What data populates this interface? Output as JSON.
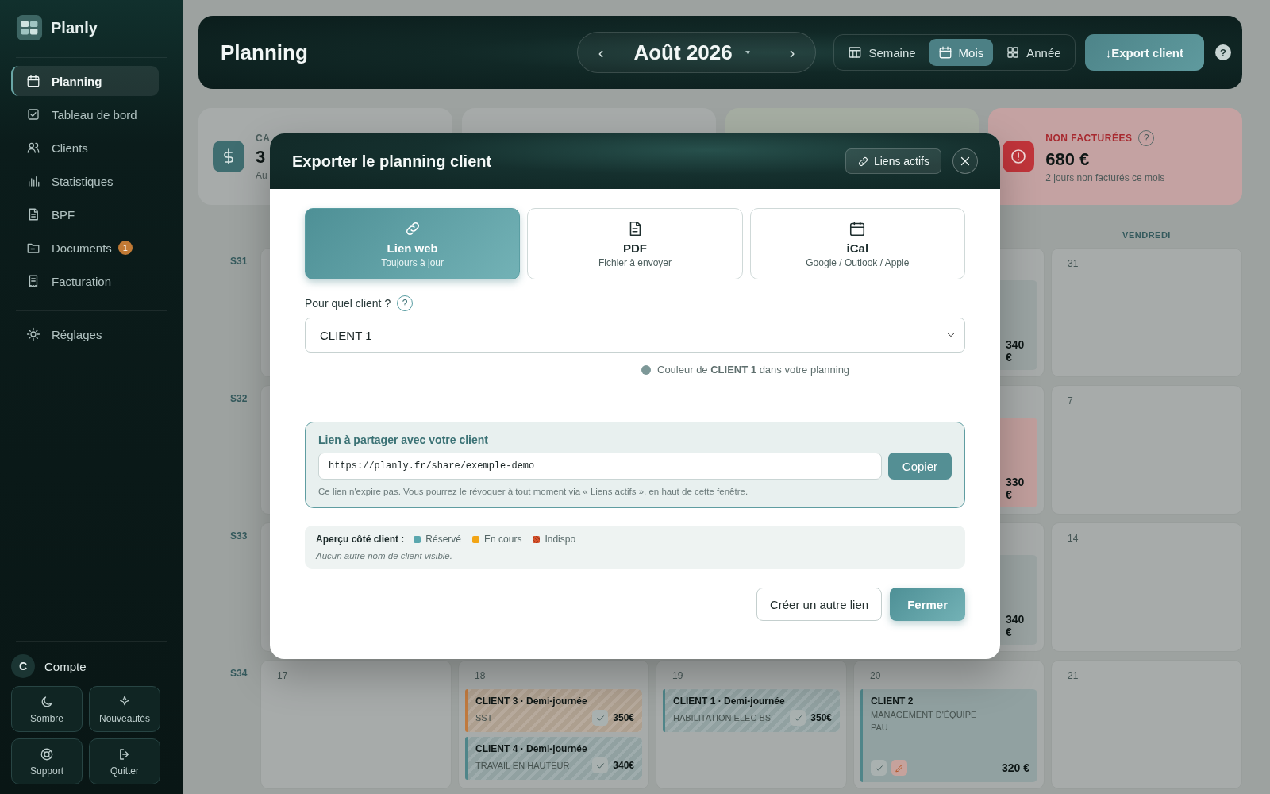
{
  "sidebar": {
    "brand": "Planly",
    "nav": [
      {
        "label": "Planning",
        "selected": true
      },
      {
        "label": "Tableau de bord",
        "selected": false
      },
      {
        "label": "Clients",
        "selected": false
      },
      {
        "label": "Statistiques",
        "selected": false
      },
      {
        "label": "BPF",
        "selected": false
      },
      {
        "label": "Documents",
        "selected": false,
        "badge": "1"
      },
      {
        "label": "Facturation",
        "selected": false
      }
    ],
    "settings": {
      "label": "Réglages",
      "selected": false
    },
    "account": {
      "initial": "C",
      "label": "Compte"
    },
    "actions": [
      {
        "label": "Sombre"
      },
      {
        "label": "Nouveautés"
      },
      {
        "label": "Support"
      },
      {
        "label": "Quitter"
      }
    ]
  },
  "header": {
    "title": "Planning",
    "prev": "‹",
    "month": "Août 2026",
    "next": "›",
    "views": [
      {
        "label": "Semaine",
        "selected": false
      },
      {
        "label": "Mois",
        "selected": true
      },
      {
        "label": "Année",
        "selected": false
      }
    ],
    "export_button": "↓Export client",
    "help": "?"
  },
  "stats": [
    {
      "kind": "revenue",
      "label": "CA",
      "value": "3",
      "note": "Au"
    },
    {
      "kind": "plain"
    },
    {
      "kind": "positive"
    },
    {
      "kind": "alert",
      "label": "NON FACTURÉES",
      "help": "?",
      "value": "680 €",
      "note": "2 jours non facturés ce mois"
    }
  ],
  "calendar": {
    "weekday_header": "VENDREDI",
    "weeks": [
      {
        "label": "S31",
        "days": [
          {
            "kind": "covered"
          },
          {
            "kind": "hidden"
          },
          {
            "kind": "hidden"
          },
          {
            "kind": "covered",
            "events": [
              {
                "kind": "partial",
                "amount": "340 €",
                "color": "#9aa3a2"
              }
            ]
          },
          {
            "kind": "day",
            "date": "31"
          }
        ]
      },
      {
        "label": "S32",
        "days": [
          {
            "kind": "covered"
          },
          {
            "kind": "hidden"
          },
          {
            "kind": "hidden"
          },
          {
            "kind": "covered",
            "events": [
              {
                "kind": "partial",
                "amount": "330 €",
                "color": "#c09e9c"
              }
            ]
          },
          {
            "kind": "day",
            "date": "7"
          }
        ]
      },
      {
        "label": "S33",
        "days": [
          {
            "kind": "covered"
          },
          {
            "kind": "hidden"
          },
          {
            "kind": "hidden"
          },
          {
            "kind": "covered",
            "events": [
              {
                "kind": "partial",
                "amount": "340 €",
                "color": "#9aa3a2"
              }
            ]
          },
          {
            "kind": "day",
            "date": "14"
          }
        ]
      },
      {
        "label": "S34",
        "days": [
          {
            "kind": "day",
            "date": "17"
          },
          {
            "kind": "day",
            "date": "18",
            "events": [
              {
                "kind": "compact",
                "title": "CLIENT 3 · Demi-journée",
                "details": [
                  "SST"
                ],
                "confirmed": true,
                "amount": "350€",
                "color": "#c07a3e"
              },
              {
                "kind": "compact",
                "title": "CLIENT 4 · Demi-journée",
                "details": [
                  "TRAVAIL EN HAUTEUR"
                ],
                "confirmed": true,
                "amount": "340€",
                "color": "#4f8589"
              }
            ]
          },
          {
            "kind": "day",
            "date": "19",
            "events": [
              {
                "kind": "compact",
                "title": "CLIENT 1 · Demi-journée",
                "details": [
                  "HABILITATION ELEC BS"
                ],
                "confirmed": true,
                "amount": "350€",
                "color": "#4f8589"
              }
            ]
          },
          {
            "kind": "day",
            "date": "20",
            "events": [
              {
                "kind": "full",
                "title": "CLIENT 2",
                "details": [
                  "MANAGEMENT D'ÉQUIPE",
                  "PAU"
                ],
                "confirmed": true,
                "flagged": true,
                "amount": "320 €",
                "color": "#4f8589"
              }
            ]
          },
          {
            "kind": "day",
            "date": "21"
          }
        ]
      }
    ]
  },
  "export_modal": {
    "title": "Exporter le planning client",
    "active_links": "Liens actifs",
    "formats": [
      {
        "title": "Lien web",
        "subtitle": "Toujours à jour",
        "selected": true
      },
      {
        "title": "PDF",
        "subtitle": "Fichier à envoyer",
        "selected": false
      },
      {
        "title": "iCal",
        "subtitle": "Google / Outlook / Apple",
        "selected": false
      }
    ],
    "client_label": "Pour quel client ?",
    "client_help": "?",
    "client_select": "CLIENT 1",
    "color_note": {
      "text": "Couleur de **CLIENT 1** dans votre planning",
      "color": "#7d9898"
    },
    "share": {
      "title": "Lien à partager avec votre client",
      "url": "https://planly.fr/share/exemple-demo",
      "copy": "Copier",
      "note": "Ce lien n'expire pas. Vous pourrez le révoquer à tout moment via « Liens actifs », en haut de cette fenêtre."
    },
    "preview": {
      "label": "Aperçu côté client :",
      "legend": [
        {
          "label": "Réservé",
          "color": "#5aa7ae"
        },
        {
          "label": "En cours",
          "color": "#f2a516"
        },
        {
          "label": "Indispo",
          "color": "#d8502a"
        }
      ],
      "note": "Aucun autre nom de client visible."
    },
    "buttons": [
      {
        "label": "Créer un autre lien",
        "kind": "secondary"
      },
      {
        "label": "Fermer",
        "kind": "primary"
      }
    ]
  }
}
